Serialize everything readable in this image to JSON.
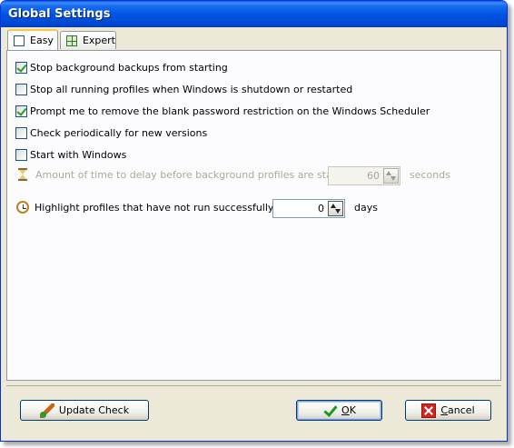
{
  "window": {
    "title": "Global Settings"
  },
  "tabs": [
    {
      "label": "Easy",
      "icon": "checkbox-icon",
      "active": true
    },
    {
      "label": "Expert",
      "icon": "grid-icon",
      "active": false
    }
  ],
  "options": [
    {
      "label": "Stop background backups from starting",
      "checked": true
    },
    {
      "label": "Stop all running profiles when Windows is shutdown or restarted",
      "checked": false
    },
    {
      "label": "Prompt me to remove the blank password restriction on the Windows Scheduler",
      "checked": true
    },
    {
      "label": "Check periodically for new versions",
      "checked": false
    },
    {
      "label": "Start with Windows",
      "checked": false
    }
  ],
  "delay": {
    "label": "Amount of time to delay before background profiles are started:",
    "value": "60",
    "unit": "seconds",
    "icon": "hourglass-icon",
    "enabled": false
  },
  "highlight": {
    "label": "Highlight profiles that have not run successfully for:",
    "value": "0",
    "unit": "days",
    "icon": "alarm-clock-icon"
  },
  "buttons": {
    "update_check": "Update Check",
    "ok_prefix": "",
    "ok_underlined": "O",
    "ok_suffix": "K",
    "cancel_underlined": "C",
    "cancel_suffix": "ancel"
  }
}
